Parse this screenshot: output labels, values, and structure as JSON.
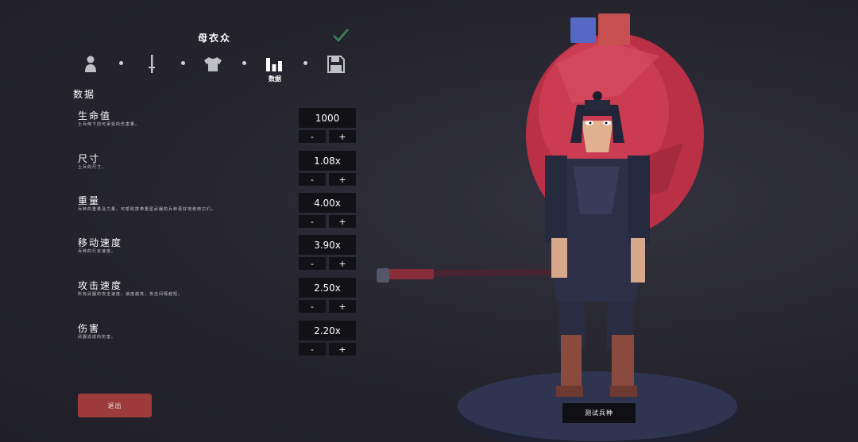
{
  "header": {
    "title": "母衣众"
  },
  "steps": [
    {
      "icon": "person-icon"
    },
    {
      "icon": "sword-icon"
    },
    {
      "icon": "shirt-icon"
    },
    {
      "icon": "bar-chart-icon",
      "label": "数据",
      "active": true
    },
    {
      "icon": "save-icon"
    }
  ],
  "section_title": "数据",
  "stats": [
    {
      "name": "生命值",
      "desc": "士兵倒下前可承受的伤害量。",
      "value": "1000"
    },
    {
      "name": "尺寸",
      "desc": "士兵的尺寸。",
      "value": "1.08x"
    },
    {
      "name": "重量",
      "desc": "兵种的重量及力量。可帮助携带重型武器的兵种更好地使用它们。",
      "value": "4.00x"
    },
    {
      "name": "移动速度",
      "desc": "兵种的行走速度。",
      "value": "3.90x"
    },
    {
      "name": "攻击速度",
      "desc": "所有武器的攻击速度。速度越高，攻击间隔越短。",
      "value": "2.50x"
    },
    {
      "name": "伤害",
      "desc": "武器造成的伤害。",
      "value": "2.20x"
    }
  ],
  "stepper": {
    "minus": "-",
    "plus": "+"
  },
  "exit_label": "退出",
  "test_unit_label": "测试兵种",
  "colors": {
    "team_blue": "#5468c4",
    "team_red": "#c5504f",
    "exit_button": "#9c3a3c",
    "balloon": "#c53a50"
  }
}
